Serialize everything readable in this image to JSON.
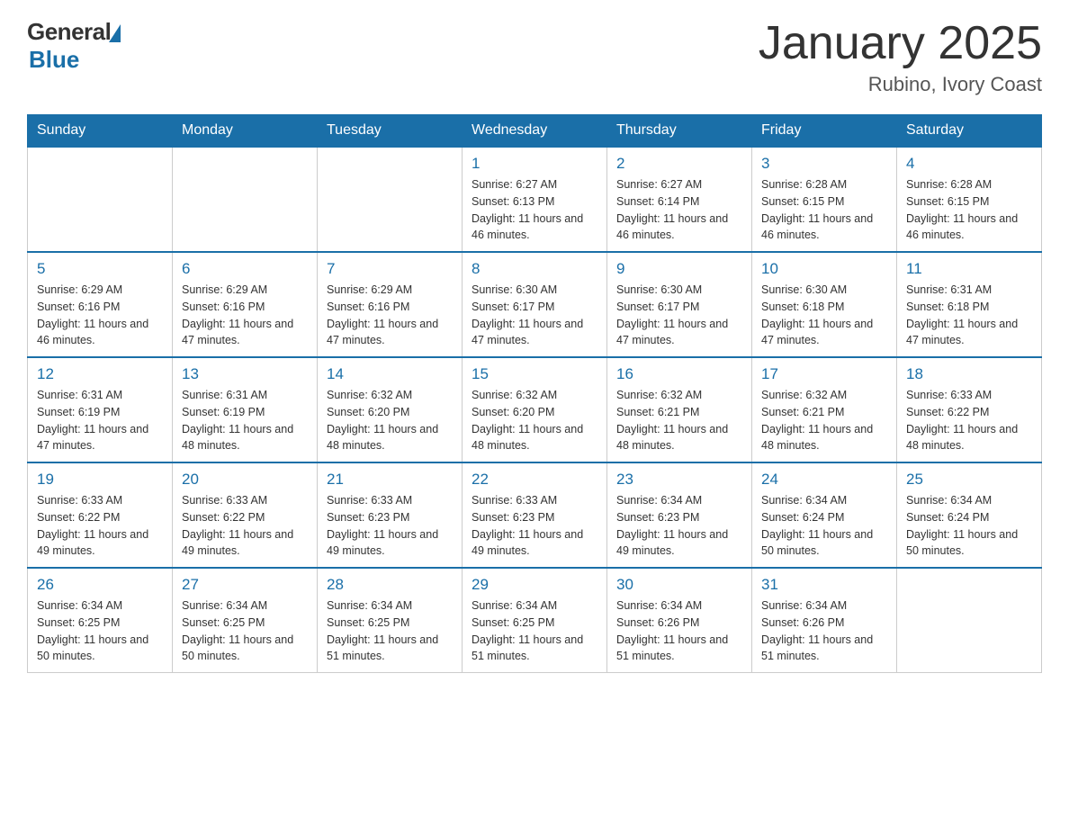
{
  "header": {
    "logo_general": "General",
    "logo_blue": "Blue",
    "month_title": "January 2025",
    "location": "Rubino, Ivory Coast"
  },
  "days_of_week": [
    "Sunday",
    "Monday",
    "Tuesday",
    "Wednesday",
    "Thursday",
    "Friday",
    "Saturday"
  ],
  "weeks": [
    [
      {
        "day": "",
        "info": ""
      },
      {
        "day": "",
        "info": ""
      },
      {
        "day": "",
        "info": ""
      },
      {
        "day": "1",
        "info": "Sunrise: 6:27 AM\nSunset: 6:13 PM\nDaylight: 11 hours and 46 minutes."
      },
      {
        "day": "2",
        "info": "Sunrise: 6:27 AM\nSunset: 6:14 PM\nDaylight: 11 hours and 46 minutes."
      },
      {
        "day": "3",
        "info": "Sunrise: 6:28 AM\nSunset: 6:15 PM\nDaylight: 11 hours and 46 minutes."
      },
      {
        "day": "4",
        "info": "Sunrise: 6:28 AM\nSunset: 6:15 PM\nDaylight: 11 hours and 46 minutes."
      }
    ],
    [
      {
        "day": "5",
        "info": "Sunrise: 6:29 AM\nSunset: 6:16 PM\nDaylight: 11 hours and 46 minutes."
      },
      {
        "day": "6",
        "info": "Sunrise: 6:29 AM\nSunset: 6:16 PM\nDaylight: 11 hours and 47 minutes."
      },
      {
        "day": "7",
        "info": "Sunrise: 6:29 AM\nSunset: 6:16 PM\nDaylight: 11 hours and 47 minutes."
      },
      {
        "day": "8",
        "info": "Sunrise: 6:30 AM\nSunset: 6:17 PM\nDaylight: 11 hours and 47 minutes."
      },
      {
        "day": "9",
        "info": "Sunrise: 6:30 AM\nSunset: 6:17 PM\nDaylight: 11 hours and 47 minutes."
      },
      {
        "day": "10",
        "info": "Sunrise: 6:30 AM\nSunset: 6:18 PM\nDaylight: 11 hours and 47 minutes."
      },
      {
        "day": "11",
        "info": "Sunrise: 6:31 AM\nSunset: 6:18 PM\nDaylight: 11 hours and 47 minutes."
      }
    ],
    [
      {
        "day": "12",
        "info": "Sunrise: 6:31 AM\nSunset: 6:19 PM\nDaylight: 11 hours and 47 minutes."
      },
      {
        "day": "13",
        "info": "Sunrise: 6:31 AM\nSunset: 6:19 PM\nDaylight: 11 hours and 48 minutes."
      },
      {
        "day": "14",
        "info": "Sunrise: 6:32 AM\nSunset: 6:20 PM\nDaylight: 11 hours and 48 minutes."
      },
      {
        "day": "15",
        "info": "Sunrise: 6:32 AM\nSunset: 6:20 PM\nDaylight: 11 hours and 48 minutes."
      },
      {
        "day": "16",
        "info": "Sunrise: 6:32 AM\nSunset: 6:21 PM\nDaylight: 11 hours and 48 minutes."
      },
      {
        "day": "17",
        "info": "Sunrise: 6:32 AM\nSunset: 6:21 PM\nDaylight: 11 hours and 48 minutes."
      },
      {
        "day": "18",
        "info": "Sunrise: 6:33 AM\nSunset: 6:22 PM\nDaylight: 11 hours and 48 minutes."
      }
    ],
    [
      {
        "day": "19",
        "info": "Sunrise: 6:33 AM\nSunset: 6:22 PM\nDaylight: 11 hours and 49 minutes."
      },
      {
        "day": "20",
        "info": "Sunrise: 6:33 AM\nSunset: 6:22 PM\nDaylight: 11 hours and 49 minutes."
      },
      {
        "day": "21",
        "info": "Sunrise: 6:33 AM\nSunset: 6:23 PM\nDaylight: 11 hours and 49 minutes."
      },
      {
        "day": "22",
        "info": "Sunrise: 6:33 AM\nSunset: 6:23 PM\nDaylight: 11 hours and 49 minutes."
      },
      {
        "day": "23",
        "info": "Sunrise: 6:34 AM\nSunset: 6:23 PM\nDaylight: 11 hours and 49 minutes."
      },
      {
        "day": "24",
        "info": "Sunrise: 6:34 AM\nSunset: 6:24 PM\nDaylight: 11 hours and 50 minutes."
      },
      {
        "day": "25",
        "info": "Sunrise: 6:34 AM\nSunset: 6:24 PM\nDaylight: 11 hours and 50 minutes."
      }
    ],
    [
      {
        "day": "26",
        "info": "Sunrise: 6:34 AM\nSunset: 6:25 PM\nDaylight: 11 hours and 50 minutes."
      },
      {
        "day": "27",
        "info": "Sunrise: 6:34 AM\nSunset: 6:25 PM\nDaylight: 11 hours and 50 minutes."
      },
      {
        "day": "28",
        "info": "Sunrise: 6:34 AM\nSunset: 6:25 PM\nDaylight: 11 hours and 51 minutes."
      },
      {
        "day": "29",
        "info": "Sunrise: 6:34 AM\nSunset: 6:25 PM\nDaylight: 11 hours and 51 minutes."
      },
      {
        "day": "30",
        "info": "Sunrise: 6:34 AM\nSunset: 6:26 PM\nDaylight: 11 hours and 51 minutes."
      },
      {
        "day": "31",
        "info": "Sunrise: 6:34 AM\nSunset: 6:26 PM\nDaylight: 11 hours and 51 minutes."
      },
      {
        "day": "",
        "info": ""
      }
    ]
  ]
}
